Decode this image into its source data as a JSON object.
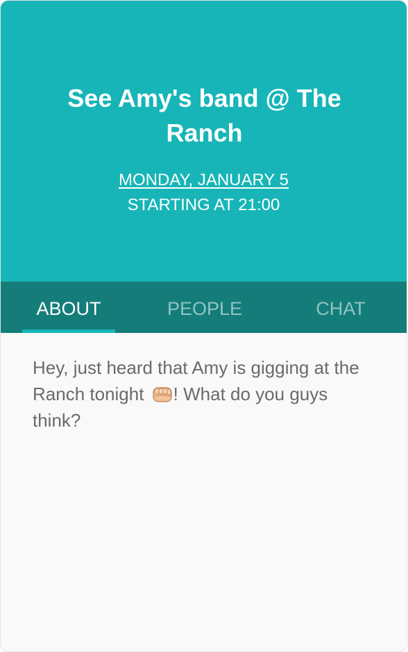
{
  "event": {
    "title": "See Amy's band @ The Ranch",
    "date": "MONDAY, JANUARY 5",
    "time": "STARTING AT 21:00"
  },
  "tabs": {
    "about": "ABOUT",
    "people": "PEOPLE",
    "chat": "CHAT",
    "active": "about"
  },
  "about": {
    "text_before_emoji": "Hey, just heard that Amy is gigging at the Ranch tonight ",
    "emoji": "fist-bump-icon",
    "text_after_emoji": "! What do you guys think?"
  },
  "colors": {
    "header": "#17b5b7",
    "tabbar": "#147d79",
    "tab_inactive": "#8fc5c2",
    "body_text": "#6a6a6a",
    "background": "#f9f9f9"
  }
}
